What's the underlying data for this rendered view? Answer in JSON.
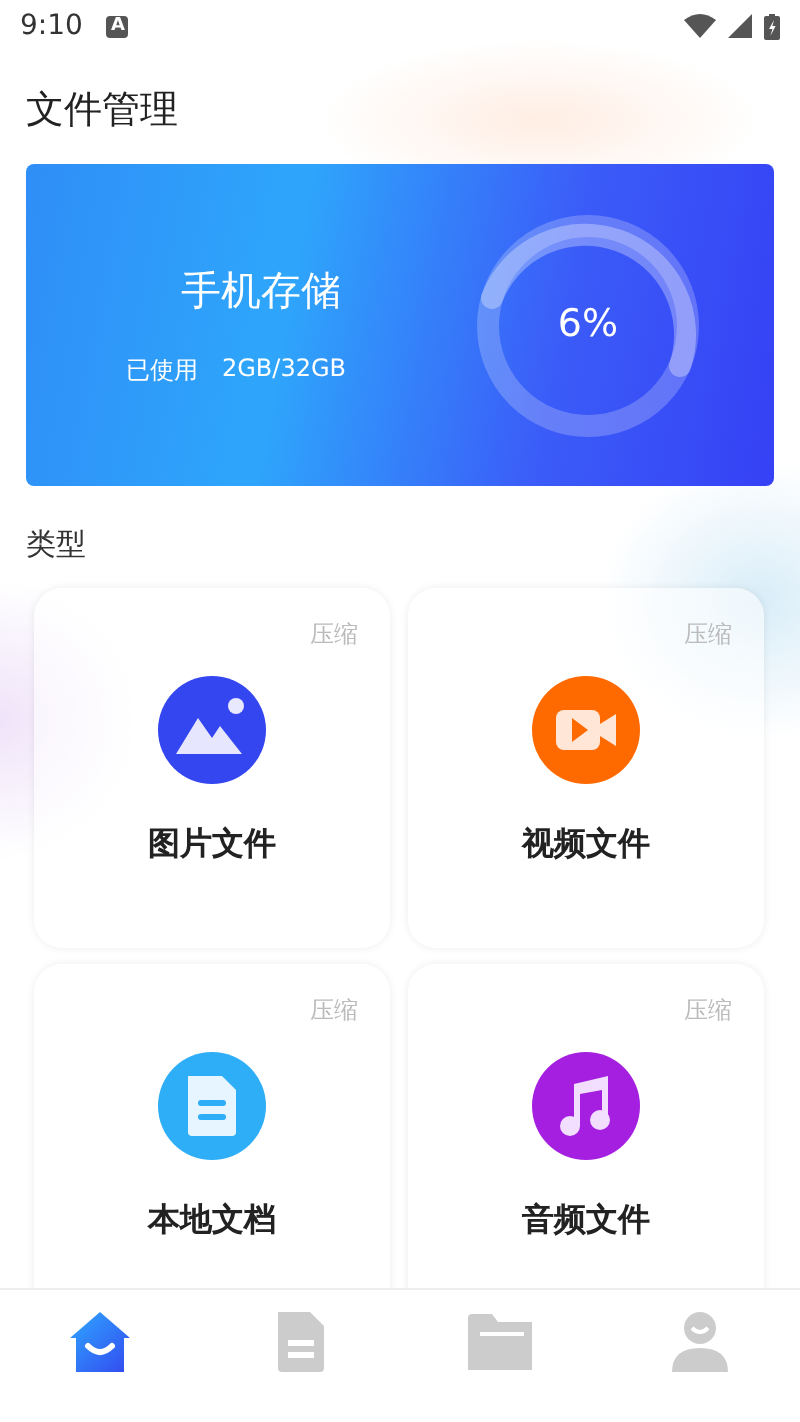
{
  "status_bar": {
    "time": "9:10",
    "notification": "A"
  },
  "title": "文件管理",
  "storage": {
    "title": "手机存储",
    "used_label": "已使用",
    "used_value": "2GB/32GB",
    "percent": "6%"
  },
  "section_title": "类型",
  "categories": [
    {
      "kind": "image",
      "label": "图片文件",
      "action": "压缩"
    },
    {
      "kind": "video",
      "label": "视频文件",
      "action": "压缩"
    },
    {
      "kind": "document",
      "label": "本地文档",
      "action": "压缩"
    },
    {
      "kind": "music",
      "label": "音频文件",
      "action": "压缩"
    }
  ],
  "tabs": [
    {
      "kind": "home",
      "selected": true
    },
    {
      "kind": "document",
      "selected": false
    },
    {
      "kind": "folder",
      "selected": false
    },
    {
      "kind": "profile",
      "selected": false
    }
  ]
}
